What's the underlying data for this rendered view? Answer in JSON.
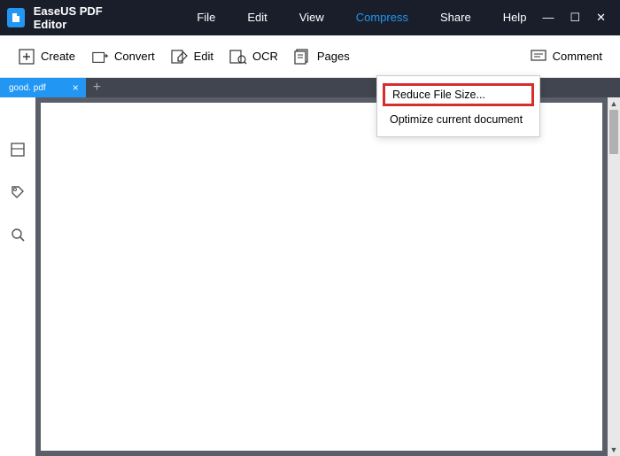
{
  "app": {
    "title": "EaseUS PDF Editor"
  },
  "menu": {
    "file": "File",
    "edit": "Edit",
    "view": "View",
    "compress": "Compress",
    "share": "Share",
    "help": "Help"
  },
  "toolbar": {
    "create": "Create",
    "convert": "Convert",
    "edit": "Edit",
    "ocr": "OCR",
    "pages": "Pages",
    "comment": "Comment"
  },
  "dropdown": {
    "reduce": "Reduce File Size...",
    "optimize": "Optimize current document"
  },
  "tabs": {
    "file": "good. pdf",
    "close": "×",
    "new": "+"
  }
}
